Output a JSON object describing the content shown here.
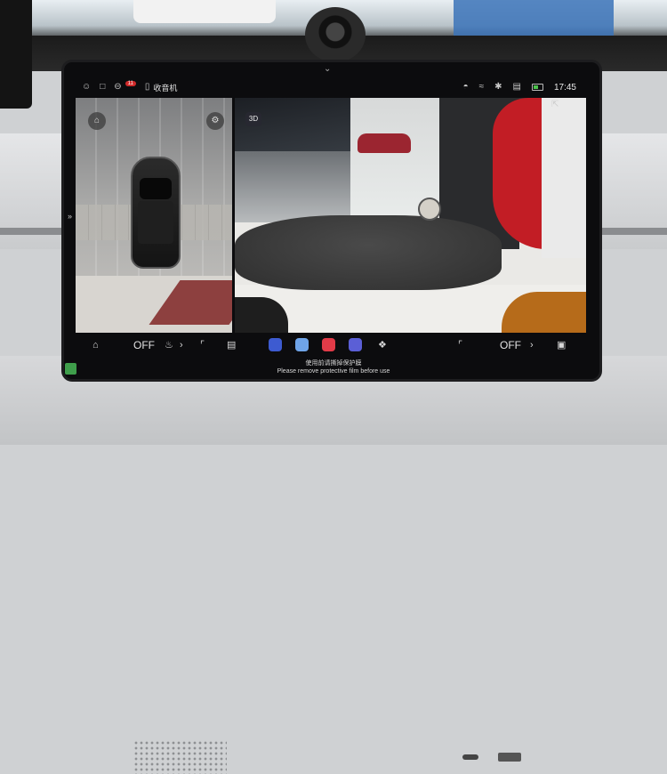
{
  "status_bar": {
    "radio_label": "收音机",
    "notification_count": "11",
    "time": "17:45"
  },
  "views": {
    "camera_mode_badge": "3D"
  },
  "dock": {
    "left_fan": "OFF",
    "right_fan": "OFF"
  },
  "notice": {
    "line1": "使用前请撕掉保护膜",
    "line2": "Please remove protective film before use"
  },
  "colors": {
    "screen_bg": "#0c0c0e",
    "notification_badge": "#d12a2a",
    "accent_red": "#c21d25"
  },
  "icons": [
    "user-icon",
    "lock-icon",
    "notification-icon",
    "radio-icon",
    "shield-icon",
    "wifi-icon",
    "bluetooth-icon",
    "signal-icon",
    "battery-icon",
    "home-icon",
    "seat-icon",
    "seat-heat-icon",
    "car-settings-icon",
    "navigation-icon",
    "music-icon",
    "phone-icon",
    "apps-icon",
    "exit-icon"
  ]
}
